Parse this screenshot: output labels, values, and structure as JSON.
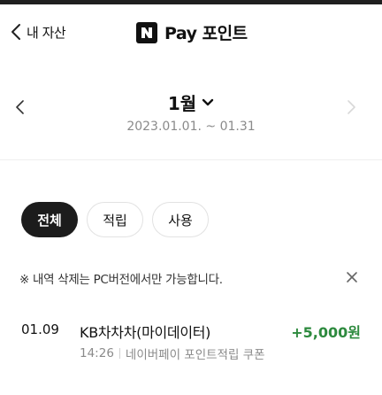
{
  "header": {
    "back_label": "내 자산",
    "brand_logo": "N",
    "brand_title": "Pay 포인트"
  },
  "period": {
    "month": "1월",
    "range": "2023.01.01. ~ 01.31"
  },
  "tabs": [
    {
      "label": "전체",
      "active": true
    },
    {
      "label": "적립",
      "active": false
    },
    {
      "label": "사용",
      "active": false
    }
  ],
  "notice": {
    "text": "※ 내역 삭제는 PC버전에서만 가능합니다."
  },
  "transactions": [
    {
      "date": "01.09",
      "title": "KB차차차(마이데이터)",
      "time": "14:26",
      "description": "네이버페이 포인트적립 쿠폰",
      "amount": "+5,000원"
    }
  ],
  "colors": {
    "accent_positive": "#2d8a3e",
    "tab_active_bg": "#1c1c1c",
    "muted_text": "#8a8a8a"
  }
}
